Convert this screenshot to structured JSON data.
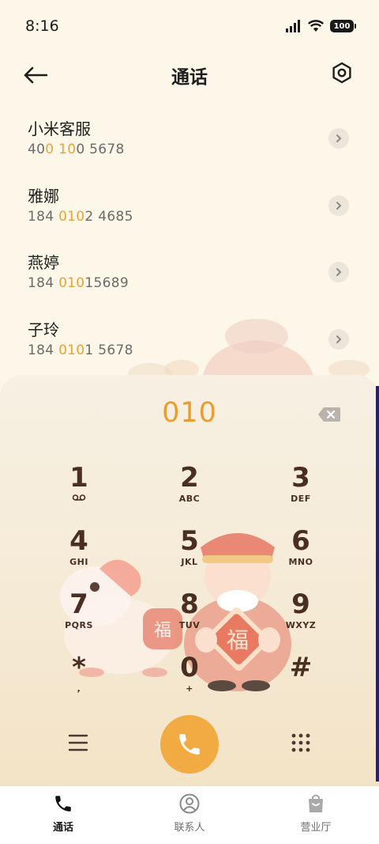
{
  "status_bar": {
    "time": "8:16",
    "battery": "100"
  },
  "header": {
    "title": "通话"
  },
  "contacts": [
    {
      "name": "小米客服",
      "number_parts": [
        "40",
        "0",
        " ",
        "10",
        "0 5678"
      ]
    },
    {
      "name": "雅娜",
      "number_parts": [
        "184 ",
        "010",
        "2 4685",
        "",
        ""
      ]
    },
    {
      "name": "燕婷",
      "number_parts": [
        "184 ",
        "010",
        "15689",
        "",
        ""
      ]
    },
    {
      "name": "子玲",
      "number_parts": [
        "184 ",
        "010",
        "1 5678",
        "",
        ""
      ]
    }
  ],
  "dialpad": {
    "input": "010",
    "keys": [
      {
        "digit": "1",
        "sub": "voicemail"
      },
      {
        "digit": "2",
        "sub": "ABC"
      },
      {
        "digit": "3",
        "sub": "DEF"
      },
      {
        "digit": "4",
        "sub": "GHI"
      },
      {
        "digit": "5",
        "sub": "JKL"
      },
      {
        "digit": "6",
        "sub": "MNO"
      },
      {
        "digit": "7",
        "sub": "PQRS"
      },
      {
        "digit": "8",
        "sub": "TUV"
      },
      {
        "digit": "9",
        "sub": "WXYZ"
      },
      {
        "digit": "*",
        "sub": ","
      },
      {
        "digit": "0",
        "sub": "+"
      },
      {
        "digit": "#",
        "sub": ""
      }
    ],
    "deco_text": "福"
  },
  "bottom_nav": {
    "items": [
      {
        "label": "通话",
        "active": true
      },
      {
        "label": "联系人",
        "active": false
      },
      {
        "label": "营业厅",
        "active": false
      }
    ]
  },
  "colors": {
    "accent": "#f2ab42",
    "highlight": "#e9a33a",
    "key_text": "#4a2e22"
  }
}
